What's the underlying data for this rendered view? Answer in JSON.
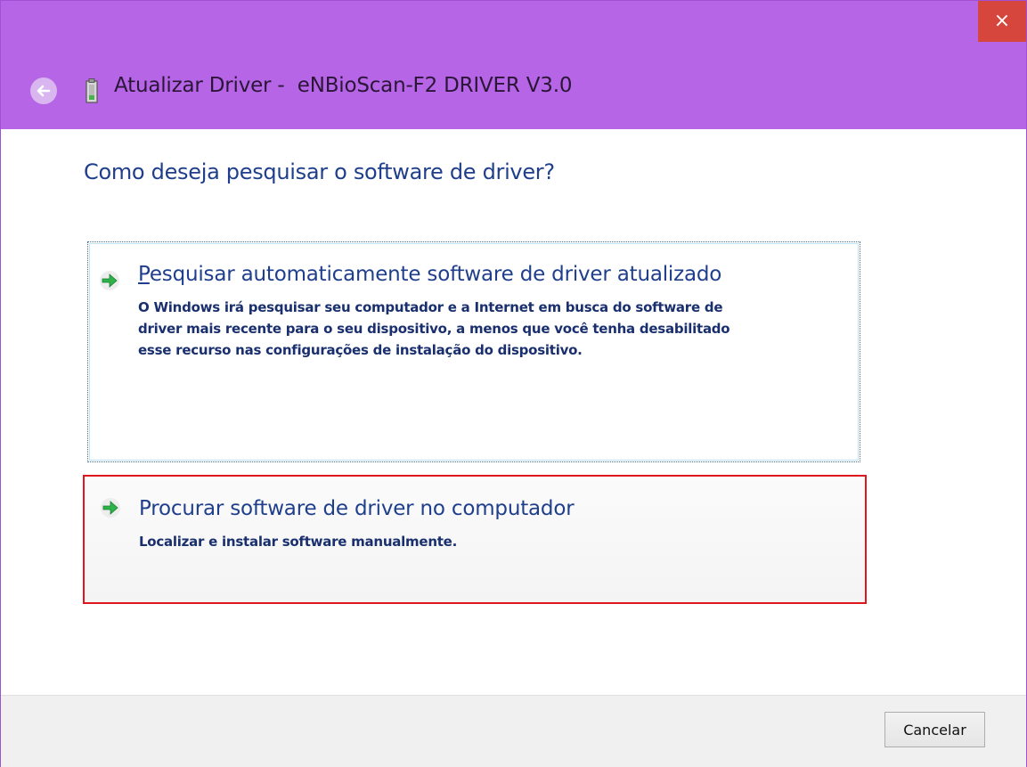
{
  "window": {
    "title": "Atualizar Driver -  eNBioScan-F2 DRIVER V3.0",
    "close_glyph": "×",
    "titlebar_color": "#b665e6",
    "close_color": "#d6463c"
  },
  "main": {
    "heading": "Como deseja pesquisar o software de driver?",
    "options": [
      {
        "title_first_letter": "P",
        "title_rest": "esquisar automaticamente software de driver atualizado",
        "description_lines": [
          "O Windows irá pesquisar seu computador e a Internet em busca do software de",
          "driver mais recente para o seu dispositivo, a menos que você tenha desabilitado",
          "esse recurso nas configurações de instalação do dispositivo."
        ],
        "icon": "green-arrow-icon"
      },
      {
        "title": "Procurar software de driver no computador",
        "description": "Localizar e instalar software manualmente.",
        "icon": "green-arrow-icon",
        "highlight_color": "#e0161e"
      }
    ]
  },
  "footer": {
    "cancel_label": "Cancelar"
  }
}
